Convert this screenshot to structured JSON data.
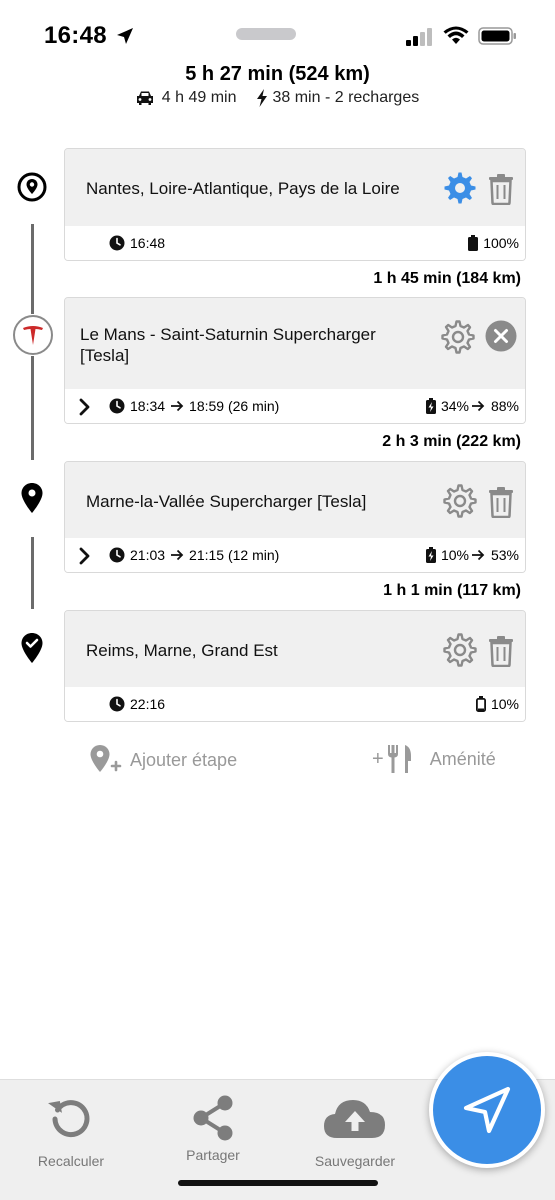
{
  "status": {
    "time": "16:48"
  },
  "summary": {
    "total": "5 h 27 min (524 km)",
    "drive_time": "4 h 49 min",
    "charge_info": "38 min - 2 recharges"
  },
  "stops": [
    {
      "name": "Nantes, Loire-Atlantique, Pays de la Loire",
      "time": "16:48",
      "battery": "100%"
    },
    {
      "name": "Le Mans - Saint-Saturnin Supercharger [Tesla]",
      "arrive": "18:34",
      "depart": "18:59 (26 min)",
      "battery_in": "34%",
      "battery_out": "88%"
    },
    {
      "name": "Marne-la-Vallée Supercharger [Tesla]",
      "arrive": "21:03",
      "depart": "21:15 (12 min)",
      "battery_in": "10%",
      "battery_out": "53%"
    },
    {
      "name": "Reims, Marne, Grand Est",
      "time": "22:16",
      "battery": "10%"
    }
  ],
  "segments": [
    "1 h 45 min (184 km)",
    "2 h 3 min (222 km)",
    "1 h 1 min (117 km)"
  ],
  "actions": {
    "add_stop": "Ajouter étape",
    "amenity": "Aménité",
    "plus": "+"
  },
  "tabs": {
    "recalc": "Recalculer",
    "share": "Partager",
    "save": "Sauvegarder"
  },
  "colors": {
    "accent": "#3b8ee6",
    "tesla_red": "#cc2a2a",
    "muted": "#999999"
  }
}
